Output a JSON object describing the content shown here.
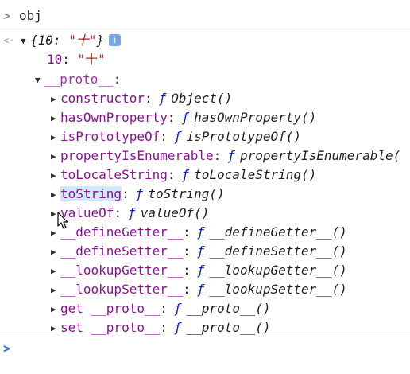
{
  "console": {
    "input_prompt": ">",
    "command": "obj",
    "result_prompt": "<·",
    "summary": {
      "open": "{",
      "key": "10",
      "colon": ":",
      "value": "\"十\"",
      "close": "}",
      "info_glyph": "i"
    },
    "own_property": {
      "key": "10",
      "colon": ":",
      "value": "\"十\""
    },
    "proto_label": "__proto__",
    "proto_colon": ":",
    "fn_glyph": "ƒ",
    "proto_members": [
      {
        "key": "constructor",
        "fn": "Object()"
      },
      {
        "key": "hasOwnProperty",
        "fn": "hasOwnProperty()"
      },
      {
        "key": "isPrototypeOf",
        "fn": "isPrototypeOf()"
      },
      {
        "key": "propertyIsEnumerable",
        "fn": "propertyIsEnumerable("
      },
      {
        "key": "toLocaleString",
        "fn": "toLocaleString()"
      },
      {
        "key": "toString",
        "fn": "toString()"
      },
      {
        "key": "valueOf",
        "fn": "valueOf()"
      },
      {
        "key": "__defineGetter__",
        "fn": "__defineGetter__()"
      },
      {
        "key": "__defineSetter__",
        "fn": "__defineSetter__()"
      },
      {
        "key": "__lookupGetter__",
        "fn": "__lookupGetter__()"
      },
      {
        "key": "__lookupSetter__",
        "fn": "__lookupSetter__()"
      },
      {
        "key": "get __proto__",
        "fn": "__proto__()"
      },
      {
        "key": "set __proto__",
        "fn": "__proto__()"
      }
    ],
    "next_prompt": ">"
  },
  "colors": {
    "key": "#881391",
    "string": "#c41a16",
    "function_glyph": "#0d22aa",
    "prompt_blue": "#1a73e8",
    "highlight": "#cfe8fc"
  },
  "icons": {
    "expand": "triangle-right-icon",
    "collapse": "triangle-down-icon",
    "info": "info-icon",
    "cursor": "mouse-pointer-icon"
  }
}
